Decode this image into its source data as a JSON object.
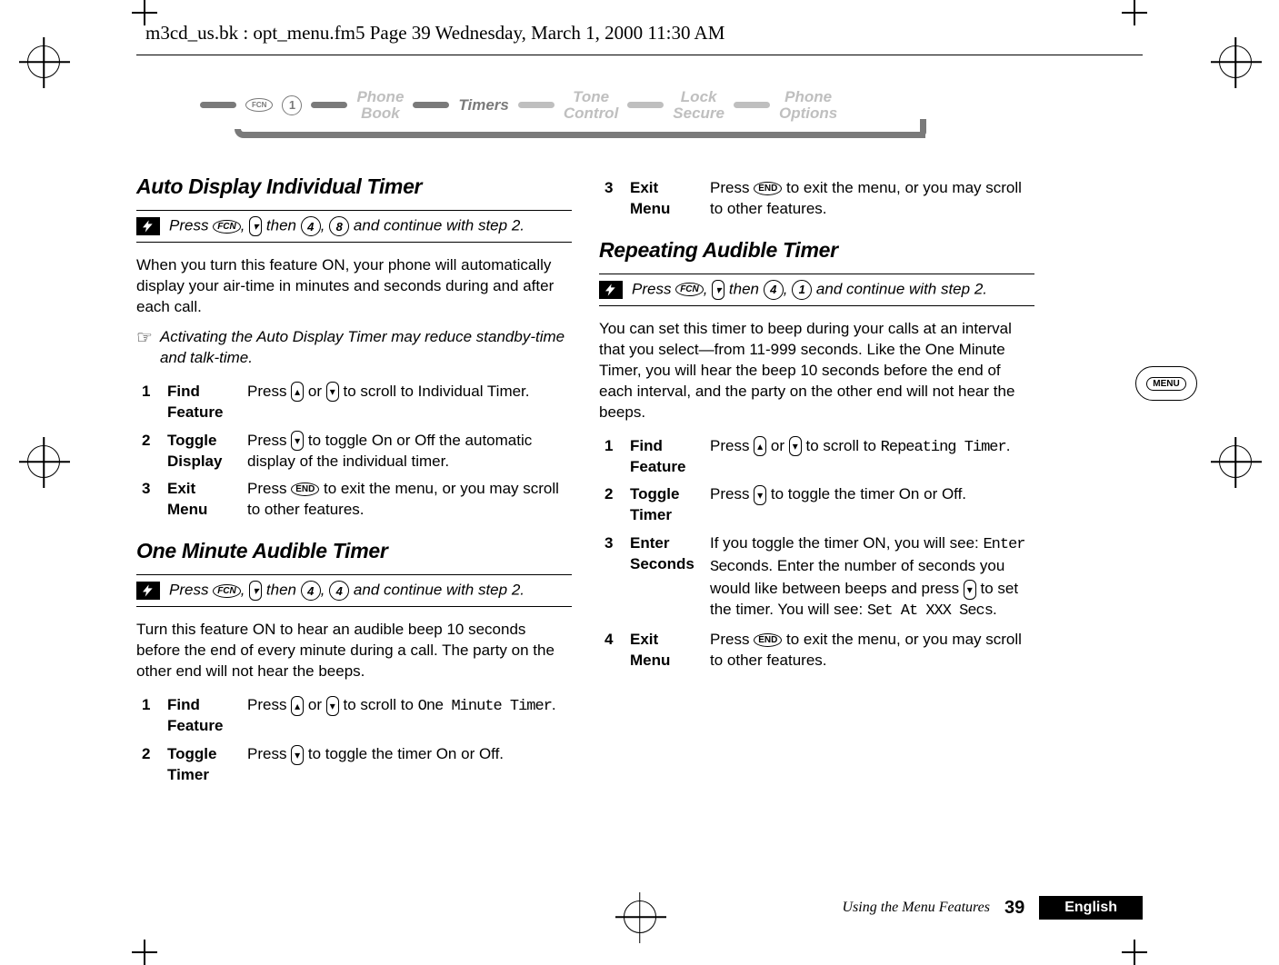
{
  "header_slug": "m3cd_us.bk : opt_menu.fm5  Page 39  Wednesday, March 1, 2000  11:30 AM",
  "nav": {
    "fcn": "FCN",
    "one": "1",
    "items": [
      "Phone\nBook",
      "Timers",
      "Tone\nControl",
      "Lock\nSecure",
      "Phone\nOptions"
    ],
    "current_index": 1
  },
  "keys": {
    "fcn": "FCN",
    "end": "END",
    "k4": "4",
    "k8": "8",
    "k1": "1"
  },
  "left": {
    "h_auto": "Auto Display Individual Timer",
    "sc_auto": [
      "Press ",
      ", ",
      " then ",
      ", ",
      " and continue with step 2."
    ],
    "p_auto": "When you turn this feature ON, your phone will automatically display your air-time in minutes and seconds during and after each call.",
    "note_auto": "Activating the Auto Display Timer may reduce standby-time and talk-time.",
    "steps_auto": [
      {
        "n": "1",
        "label": "Find Feature",
        "body": [
          "Press ",
          " or ",
          " to scroll to Individual Timer."
        ]
      },
      {
        "n": "2",
        "label": "Toggle Display",
        "body": [
          "Press ",
          " to toggle On or Off the automatic display of the individual timer."
        ]
      },
      {
        "n": "3",
        "label": "Exit Menu",
        "body": [
          "Press ",
          " to exit the menu, or you may scroll to other features."
        ]
      }
    ],
    "h_one": "One Minute Audible Timer",
    "sc_one": [
      "Press ",
      ", ",
      " then ",
      ", ",
      " and continue with step 2."
    ],
    "p_one": "Turn this feature ON to hear an audible beep 10 seconds before the end of every minute during a call. The party on the other end will not hear the beeps.",
    "steps_one": [
      {
        "n": "1",
        "label": "Find Feature",
        "body": [
          "Press ",
          " or ",
          " to scroll to ",
          "One Minute Timer",
          "."
        ]
      },
      {
        "n": "2",
        "label": "Toggle Timer",
        "body": [
          "Press ",
          " to toggle the timer On or Off."
        ]
      }
    ]
  },
  "right": {
    "step3": {
      "n": "3",
      "label": "Exit Menu",
      "body": [
        "Press ",
        " to exit the menu, or you may scroll to other features."
      ]
    },
    "h_rep": "Repeating Audible Timer",
    "sc_rep": [
      "Press ",
      ", ",
      " then ",
      ", ",
      " and continue with step 2."
    ],
    "p_rep": "You can set this timer to beep during your calls at an interval that you select—from 11-999 seconds. Like the One Minute Timer, you will hear the beep 10 seconds before the end of each interval, and the party on the other end will not hear the beeps.",
    "steps_rep": [
      {
        "n": "1",
        "label": "Find Feature",
        "body": [
          "Press ",
          " or ",
          " to scroll to ",
          "Repeating Timer",
          "."
        ]
      },
      {
        "n": "2",
        "label": "Toggle Timer",
        "body": [
          "Press ",
          " to toggle the timer On or Off."
        ]
      },
      {
        "n": "3",
        "label": "Enter Seconds",
        "body": [
          "If you toggle the timer ON, you will see: ",
          "Enter Seconds",
          ". Enter the number of seconds you would like between beeps and press ",
          " to set the timer. You will see: ",
          "Set At XXX Secs",
          "."
        ]
      },
      {
        "n": "4",
        "label": "Exit Menu",
        "body": [
          "Press ",
          " to exit the menu, or you may scroll to other features."
        ]
      }
    ]
  },
  "menu_tab": "MENU",
  "footer": {
    "title": "Using the Menu Features",
    "page": "39",
    "lang": "English"
  }
}
